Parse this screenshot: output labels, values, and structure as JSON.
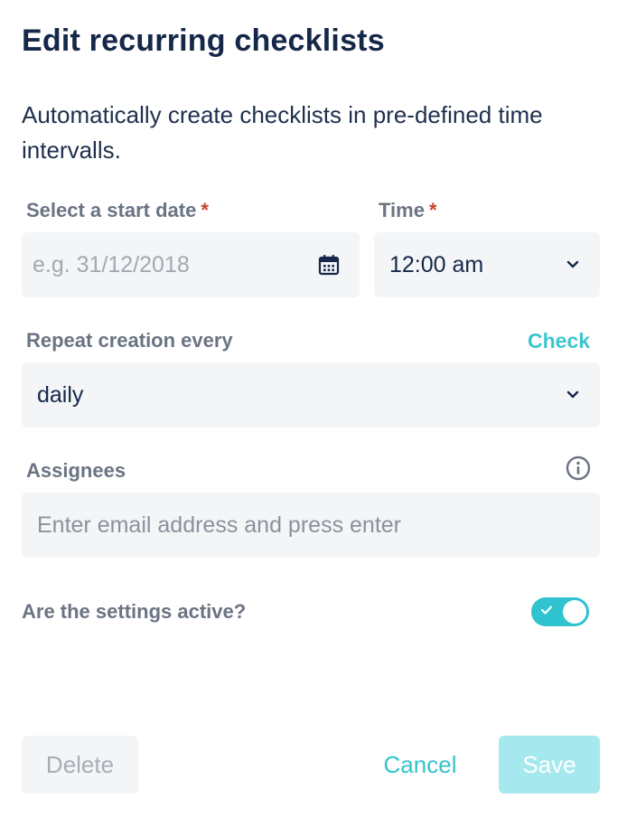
{
  "dialog": {
    "title": "Edit recurring checklists",
    "description": "Automatically create checklists in pre-defined time intervalls."
  },
  "start_date": {
    "label": "Select a start date",
    "required_mark": "*",
    "placeholder": "e.g. 31/12/2018",
    "icon": "calendar-icon"
  },
  "time": {
    "label": "Time",
    "required_mark": "*",
    "value": "12:00 am",
    "icon": "chevron-down-icon"
  },
  "repeat": {
    "label": "Repeat creation every",
    "check_link": "Check",
    "value": "daily",
    "icon": "chevron-down-icon"
  },
  "assignees": {
    "label": "Assignees",
    "placeholder": "Enter email address and press enter",
    "icon": "info-icon"
  },
  "active": {
    "label": "Are the settings active?",
    "enabled": true
  },
  "actions": {
    "delete_label": "Delete",
    "cancel_label": "Cancel",
    "save_label": "Save"
  },
  "colors": {
    "accent": "#2fc3cf",
    "required": "#c8452b",
    "field_bg": "#f3f5f7",
    "title": "#16284a"
  }
}
